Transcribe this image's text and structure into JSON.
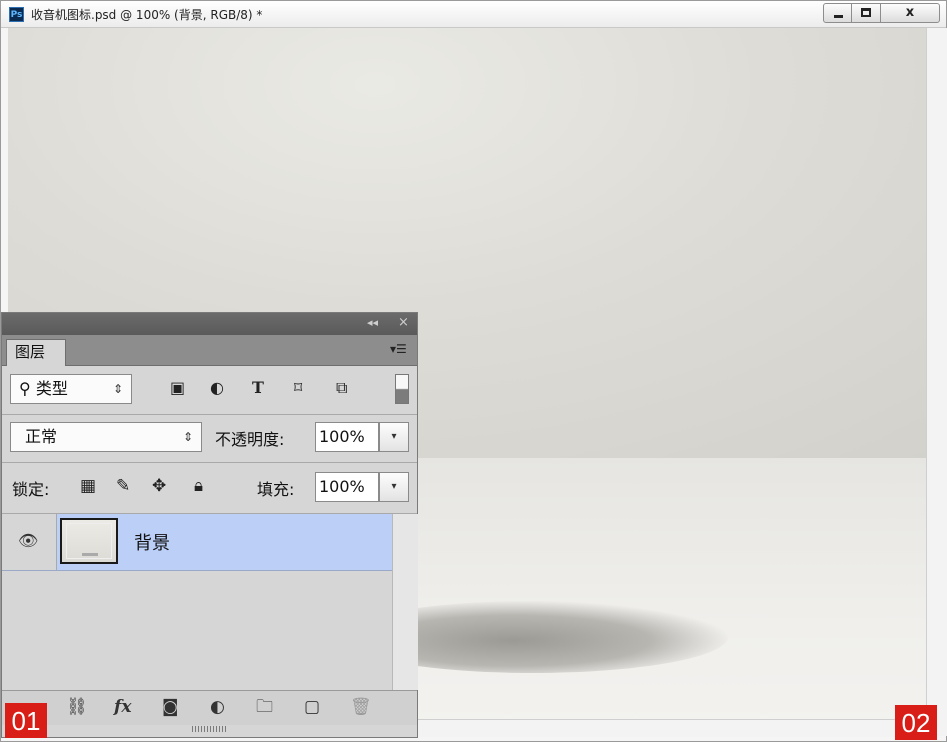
{
  "window": {
    "title": "收音机图标.psd @ 100% (背景, RGB/8) *",
    "app_icon": "Ps",
    "controls": {
      "minimize": "minimize-icon",
      "maximize": "maximize-icon",
      "close": "x"
    }
  },
  "layers_panel": {
    "tab_label": "图层",
    "filter": {
      "icon": "search-icon",
      "label": "类型"
    },
    "blend_mode": "正常",
    "opacity_label": "不透明度:",
    "opacity_value": "100%",
    "lock_label": "锁定:",
    "fill_label": "填充:",
    "fill_value": "100%",
    "layers": [
      {
        "name": "背景",
        "visible": true,
        "selected": true
      }
    ],
    "selected_row_color": "#bccff7"
  },
  "badges": {
    "left": "01",
    "right": "02",
    "color": "#d91e18"
  }
}
